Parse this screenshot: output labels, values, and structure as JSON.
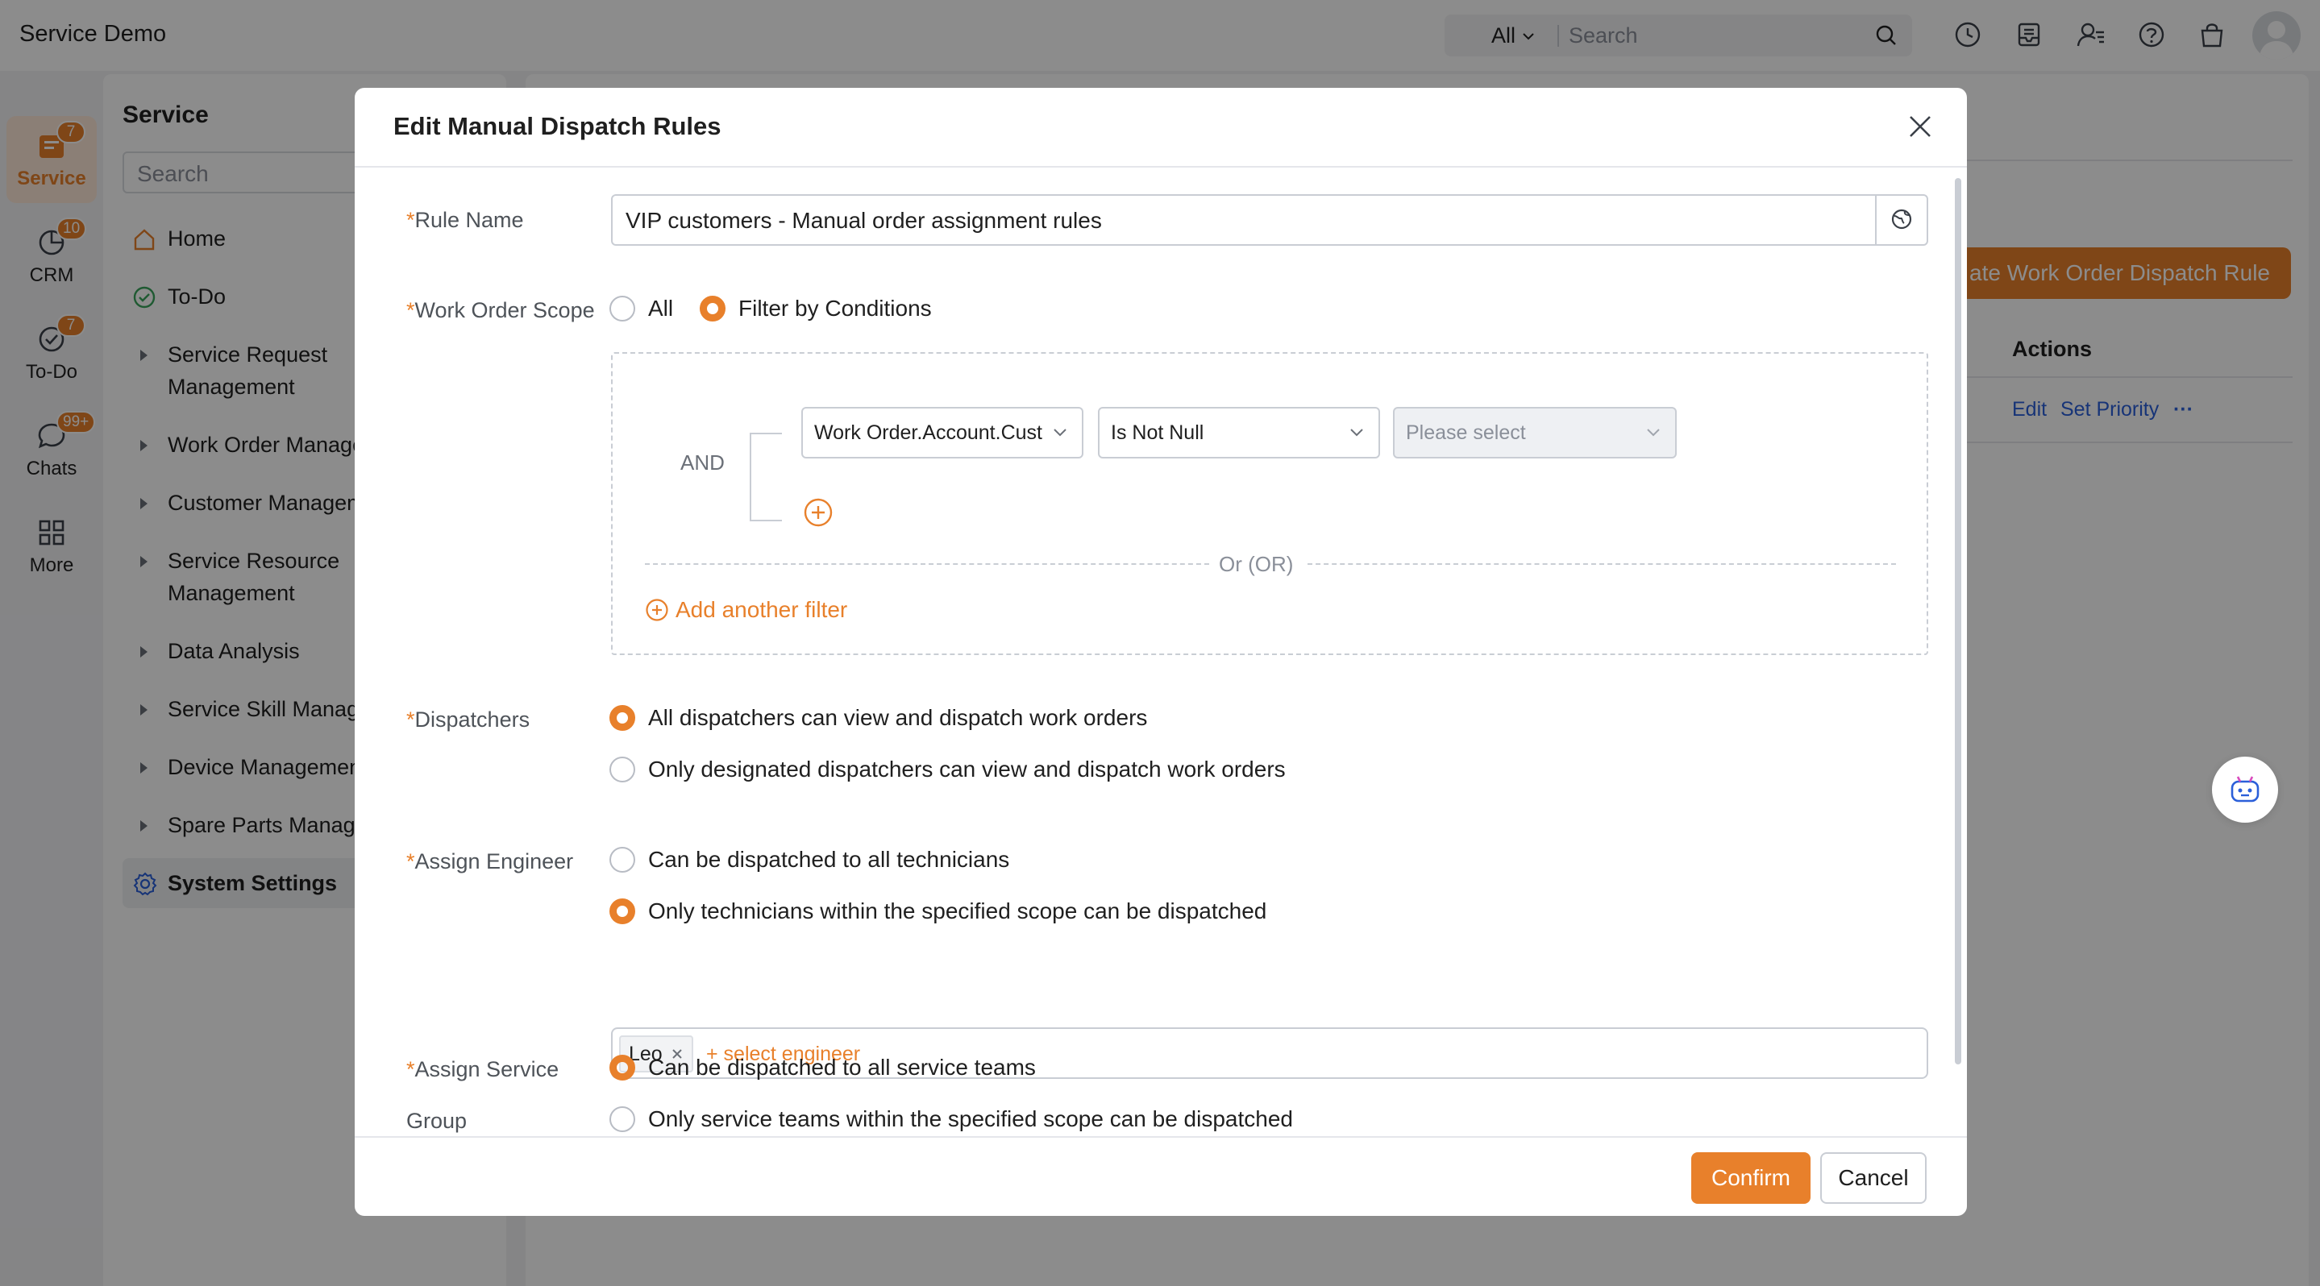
{
  "app": {
    "title": "Service Demo"
  },
  "topbar": {
    "search_scope": "All",
    "search_placeholder": "Search",
    "icons": [
      "search-icon",
      "clock-icon",
      "inbox-icon",
      "user-settings-icon",
      "help-icon",
      "bag-icon",
      "avatar"
    ]
  },
  "rail": {
    "items": [
      {
        "label": "Service",
        "badge": "7",
        "icon": "service-icon"
      },
      {
        "label": "CRM",
        "badge": "10",
        "icon": "crm-icon"
      },
      {
        "label": "To-Do",
        "badge": "7",
        "icon": "todo-icon"
      },
      {
        "label": "Chats",
        "badge": "99+",
        "icon": "chat-icon"
      },
      {
        "label": "More",
        "icon": "grid-icon"
      }
    ]
  },
  "sidebar": {
    "title": "Service",
    "search_placeholder": "Search",
    "items": [
      {
        "label": "Home"
      },
      {
        "label": "To-Do"
      },
      {
        "label": "Service Request",
        "label2": "Management"
      },
      {
        "label": "Work Order Manage"
      },
      {
        "label": "Customer Managem"
      },
      {
        "label": "Service Resource",
        "label2": "Management"
      },
      {
        "label": "Data Analysis"
      },
      {
        "label": "Service Skill Manage"
      },
      {
        "label": "Device Managemen"
      },
      {
        "label": "Spare Parts Manage"
      },
      {
        "label": "System Settings"
      }
    ]
  },
  "main": {
    "create_button": "ate Work Order Dispatch Rule",
    "actions_header": "Actions",
    "row_actions": {
      "edit": "Edit",
      "set_priority": "Set Priority",
      "more": "···"
    }
  },
  "modal": {
    "title": "Edit Manual Dispatch Rules",
    "rule_name": {
      "label": "Rule Name",
      "required": "*",
      "value": "VIP customers - Manual order assignment rules"
    },
    "scope": {
      "label": "Work Order Scope",
      "required": "*",
      "options": [
        "All",
        "Filter by Conditions"
      ],
      "selected": "Filter by Conditions",
      "and_label": "AND",
      "condition": {
        "field": "Work Order.Account.Cust",
        "operator": "Is Not Null",
        "value_placeholder": "Please select"
      },
      "or_label": "Or (OR)",
      "add_filter": "Add another filter"
    },
    "dispatchers": {
      "label": "Dispatchers",
      "required": "*",
      "options": [
        "All dispatchers can view and dispatch work orders",
        "Only designated dispatchers can view and dispatch work orders"
      ],
      "selected": 0
    },
    "assign_engineer": {
      "label": "Assign Engineer",
      "required": "*",
      "options": [
        "Can be dispatched to all technicians",
        "Only technicians within the specified scope can be dispatched"
      ],
      "selected": 1,
      "tags": [
        "Leo"
      ],
      "add_label": "+ select engineer"
    },
    "assign_group": {
      "label": "Assign Service",
      "label2": "Group",
      "required": "*",
      "options": [
        "Can be dispatched to all service teams",
        "Only service teams within the specified scope can be dispatched"
      ],
      "selected": 0
    },
    "confirm": "Confirm",
    "cancel": "Cancel"
  },
  "colors": {
    "accent": "#e8802b",
    "link": "#2b5fd9",
    "overlay": "rgba(0,0,0,0.45)"
  }
}
